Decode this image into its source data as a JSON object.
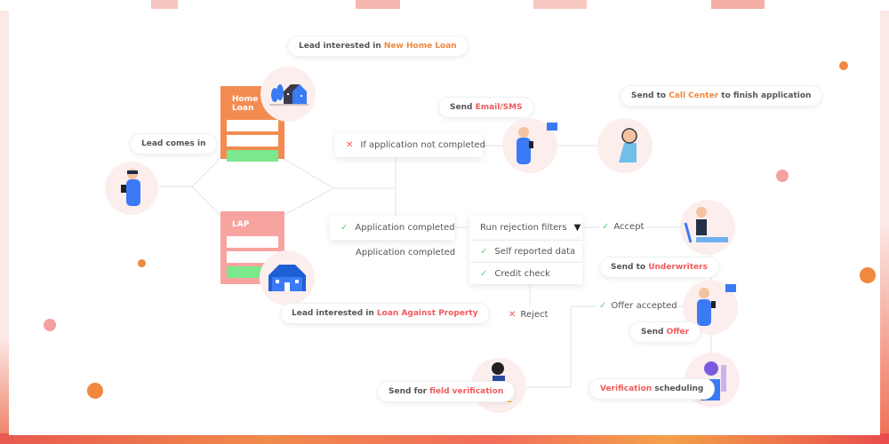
{
  "bubbles": {
    "lead_comes_in": "Lead comes in",
    "home_loan_prefix": "Lead interested in ",
    "home_loan_highlight": "New Home Loan",
    "lap_prefix": "Lead interested in ",
    "lap_highlight": "Loan Against Property",
    "email_prefix": "Send ",
    "email_highlight": "Email/SMS",
    "call_prefix": "Send to ",
    "call_highlight": "Call Center",
    "call_suffix": " to finish application",
    "uw_prefix": "Send to ",
    "uw_highlight": "Underwriters",
    "offer_prefix": "Send ",
    "offer_highlight": "Offer",
    "verif_highlight": "Verification",
    "verif_suffix": " scheduling",
    "field_prefix": "Send for ",
    "field_highlight": "field verification"
  },
  "forms": {
    "home_loan_title": "Home Loan",
    "lap_title": "LAP"
  },
  "steps": {
    "not_completed": "If application not completed",
    "completed": "Application completed",
    "completed_caption": "Application completed",
    "rejection_filters": "Run rejection filters",
    "self_reported": "Self reported data",
    "credit_check": "Credit check",
    "accept": "Accept",
    "reject": "Reject",
    "offer_accepted": "Offer accepted"
  },
  "colors": {
    "orange": "#f0883e",
    "red": "#f05a5a",
    "green": "#5fd07a",
    "form_orange": "#f28c50",
    "form_pink": "#f7a3a0",
    "blue": "#3a7bf5"
  }
}
